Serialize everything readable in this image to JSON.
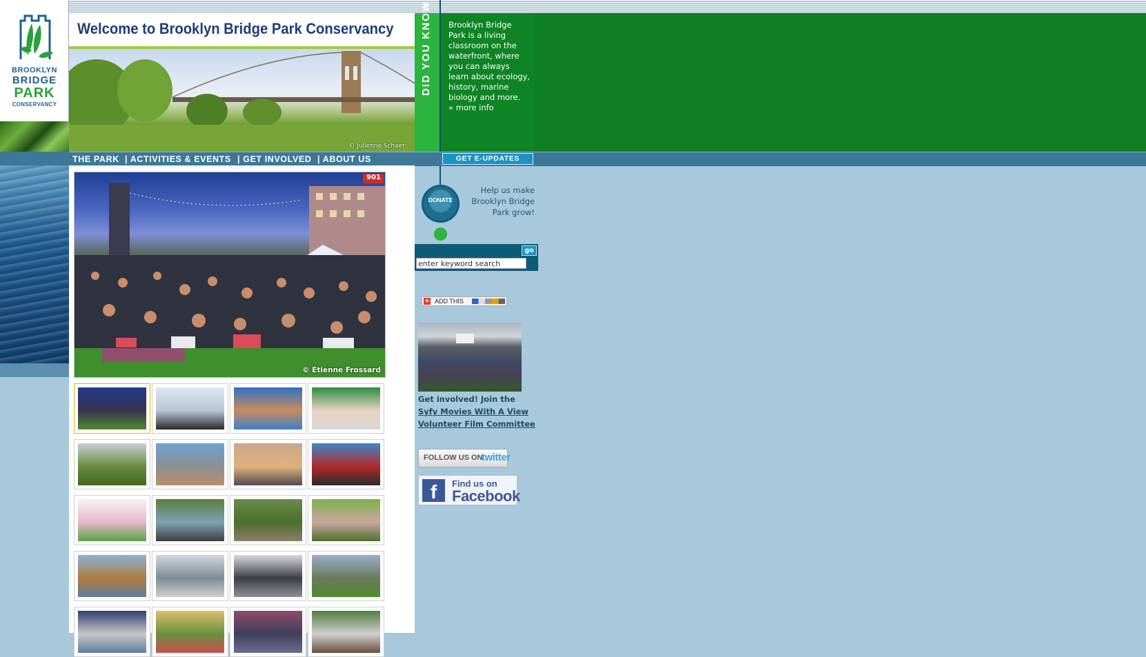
{
  "logo": {
    "line1": "BROOKLYN",
    "line2": "BRIDGE",
    "line3": "PARK",
    "line4": "CONSERVANCY",
    "colors": {
      "blue": "#1f5f93",
      "green": "#2aa13a"
    }
  },
  "header": {
    "title": "Welcome to Brooklyn Bridge Park Conservancy",
    "photo_credit": "© Julienne Schaer"
  },
  "did_you_know": {
    "heading": "DID YOU KNOW",
    "body": "Brooklyn Bridge Park is a living classroom on the waterfront, where you can always learn about ecology, history, marine biology and more.",
    "more_link": "» more info"
  },
  "nav": {
    "items": [
      {
        "label": "THE PARK"
      },
      {
        "label": "| ACTIVITIES & EVENTS"
      },
      {
        "label": "| GET INVOLVED"
      },
      {
        "label": "| ABOUT US"
      }
    ],
    "eupdates_label": "GET  E-UPDATES"
  },
  "main_photo": {
    "credit": "© Etienne Frossard",
    "sign": "901"
  },
  "thumbnails": [
    {
      "selected": true,
      "colors": [
        "#1f3a8e",
        "#3a3350",
        "#4e8c2c"
      ]
    },
    {
      "selected": false,
      "colors": [
        "#dfe7ee",
        "#b6c6d4",
        "#2a2a2a"
      ]
    },
    {
      "selected": false,
      "colors": [
        "#2f6fc7",
        "#c98d5c",
        "#3b7fc9"
      ]
    },
    {
      "selected": false,
      "colors": [
        "#2c8d44",
        "#e8d2c0",
        "#d9d9d9"
      ]
    },
    {
      "selected": false,
      "colors": [
        "#c7d2d9",
        "#6b8a3f",
        "#3f6b1d"
      ]
    },
    {
      "selected": false,
      "colors": [
        "#6fa3d6",
        "#8b8f93",
        "#b98f6b"
      ]
    },
    {
      "selected": false,
      "colors": [
        "#c9a78d",
        "#e0b27a",
        "#4f4c54"
      ]
    },
    {
      "selected": false,
      "colors": [
        "#3f86c7",
        "#b12a2a",
        "#2a2a2a"
      ]
    },
    {
      "selected": false,
      "colors": [
        "#f3f3f3",
        "#e9b6c9",
        "#5aa245"
      ]
    },
    {
      "selected": false,
      "colors": [
        "#5b7d3c",
        "#7fa2b4",
        "#3d3d3d"
      ]
    },
    {
      "selected": false,
      "colors": [
        "#6b8a4b",
        "#4b6f2c",
        "#8f7d6b"
      ]
    },
    {
      "selected": false,
      "colors": [
        "#7fb04a",
        "#c9a7a0",
        "#4e6f2e"
      ]
    },
    {
      "selected": false,
      "colors": [
        "#8ab3d9",
        "#b07a3e",
        "#5c7e9b"
      ]
    },
    {
      "selected": false,
      "colors": [
        "#cfd8df",
        "#7f8c95",
        "#cfcfcf"
      ]
    },
    {
      "selected": false,
      "colors": [
        "#d9d9e3",
        "#3d3d45",
        "#8f8f99"
      ]
    },
    {
      "selected": false,
      "colors": [
        "#9aaeca",
        "#6b7a5b",
        "#4e8c2c"
      ]
    },
    {
      "selected": false,
      "colors": [
        "#2f3f6e",
        "#c7c7c7",
        "#5f7f9f"
      ]
    },
    {
      "selected": false,
      "colors": [
        "#d9c06b",
        "#6b8f3f",
        "#c94f4f"
      ]
    },
    {
      "selected": false,
      "colors": [
        "#8e4a6b",
        "#3f3f5a",
        "#6b6b8f"
      ]
    },
    {
      "selected": false,
      "colors": [
        "#4f7f3f",
        "#cfcfcf",
        "#6b4f3f"
      ]
    }
  ],
  "donate": {
    "label": "DONATE",
    "help_text": "Help us make Brooklyn Bridge Park grow!"
  },
  "search": {
    "placeholder": "enter keyword search",
    "value": "enter keyword search",
    "go_label": "go"
  },
  "addthis": {
    "plus": "+",
    "label": "ADD THIS"
  },
  "promo": {
    "text_prefix": "Get involved! Join the",
    "link_text": "Syfy Movies With A View Volunteer Film Committee"
  },
  "social": {
    "twitter_prefix": "FOLLOW US ON",
    "twitter_word": "twitter",
    "facebook_line1": "Find us on",
    "facebook_line2": "Facebook",
    "facebook_f": "f"
  }
}
